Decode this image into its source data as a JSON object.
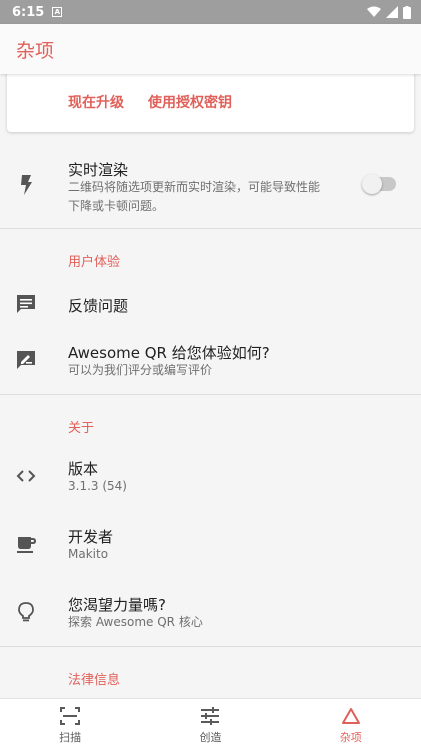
{
  "status_bar": {
    "time": "6:15",
    "notification_icon": "A"
  },
  "app_bar": {
    "title": "杂项"
  },
  "card": {
    "actions": [
      "现在升级",
      "使用授权密钥"
    ]
  },
  "settings": {
    "realtime": {
      "title": "实时渲染",
      "subtitle_line1": "二维码将随选项更新而实时渲染，可能导致性能",
      "subtitle_line2": "下降或卡顿问题。",
      "enabled": false
    },
    "ux_header": "用户体验",
    "feedback": {
      "title": "反馈问题"
    },
    "rate": {
      "title": "Awesome QR 给您体验如何?",
      "subtitle": "可以为我们评分或编写评价"
    },
    "about_header": "关于",
    "version": {
      "title": "版本",
      "subtitle": "3.1.3 (54)"
    },
    "developer": {
      "title": "开发者",
      "subtitle": "Makito"
    },
    "power": {
      "title": "您渴望力量嗎?",
      "subtitle": "探索 Awesome QR 核心"
    },
    "legal_header": "法律信息"
  },
  "bottom_nav": {
    "items": [
      {
        "label": "扫描",
        "icon": "scan-icon"
      },
      {
        "label": "创造",
        "icon": "tune-icon"
      },
      {
        "label": "杂项",
        "icon": "triangle-icon"
      }
    ],
    "active_index": 2
  },
  "colors": {
    "accent": "#e0605a",
    "status_bar": "#9e9e9e"
  }
}
